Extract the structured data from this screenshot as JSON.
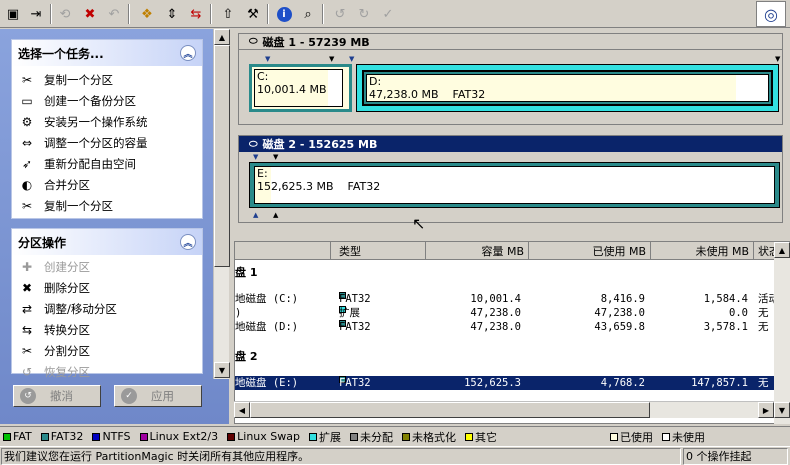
{
  "toolbar": {
    "icons": [
      "new-icon",
      "export-icon",
      "undo-disabled-icon",
      "delete-icon",
      "redo-disabled-icon",
      "copy-icon",
      "resize-icon",
      "move-icon",
      "up-icon",
      "tools-icon",
      "info-icon",
      "search-icon",
      "undo2-disabled-icon",
      "redo2-disabled-icon",
      "apply-disabled-icon"
    ]
  },
  "tasks": {
    "title": "选择一个任务...",
    "items": [
      {
        "label": "复制一个分区",
        "icon": "copy-partition-icon"
      },
      {
        "label": "创建一个备份分区",
        "icon": "backup-icon"
      },
      {
        "label": "安装另一个操作系统",
        "icon": "install-os-icon"
      },
      {
        "label": "调整一个分区的容量",
        "icon": "resize-icon"
      },
      {
        "label": "重新分配自由空间",
        "icon": "redistribute-icon"
      },
      {
        "label": "合并分区",
        "icon": "merge-icon"
      },
      {
        "label": "复制一个分区",
        "icon": "copy-partition-icon"
      }
    ]
  },
  "partition_ops": {
    "title": "分区操作",
    "items": [
      {
        "label": "创建分区",
        "disabled": true
      },
      {
        "label": "删除分区",
        "disabled": false
      },
      {
        "label": "调整/移动分区",
        "disabled": false
      },
      {
        "label": "转换分区",
        "disabled": false
      },
      {
        "label": "分割分区",
        "disabled": false
      },
      {
        "label": "恢复分区",
        "disabled": true
      }
    ]
  },
  "buttons": {
    "undo": "撤消",
    "apply": "应用"
  },
  "disks": [
    {
      "title": "磁盘 1 - 57239 MB",
      "partitions": [
        {
          "letter": "C:",
          "size": "10,001.4 MB",
          "fs": "",
          "used_fraction": 0.84
        },
        {
          "letter": "D:",
          "size": "47,238.0 MB",
          "fs": "FAT32",
          "used_fraction": 0.92
        }
      ]
    },
    {
      "title": "磁盘 2 - 152625 MB",
      "partitions": [
        {
          "letter": "E:",
          "size": "152,625.3 MB",
          "fs": "FAT32",
          "used_fraction": 0.03
        }
      ]
    }
  ],
  "table": {
    "columns": [
      "类型",
      "容量 MB",
      "已使用 MB",
      "未使用 MB",
      "状态"
    ],
    "groups": [
      {
        "name": "盘 1",
        "rows": [
          {
            "name": "地磁盘 (C:)",
            "type": "FAT32",
            "type_color": "#2a8a8a",
            "capacity": "10,001.4",
            "used": "8,416.9",
            "unused": "1,584.4",
            "status": "活动"
          },
          {
            "name": ")",
            "type": "扩展",
            "type_color": "#33e0e0",
            "capacity": "47,238.0",
            "used": "47,238.0",
            "unused": "0.0",
            "status": "无"
          },
          {
            "name": "地磁盘 (D:)",
            "type": "FAT32",
            "type_color": "#2a8a8a",
            "capacity": "47,238.0",
            "used": "43,659.8",
            "unused": "3,578.1",
            "status": "无"
          }
        ]
      },
      {
        "name": "盘 2",
        "rows": [
          {
            "name": "地磁盘 (E:)",
            "type": "FAT32",
            "type_color": "#2a8a8a",
            "capacity": "152,625.3",
            "used": "4,768.2",
            "unused": "147,857.1",
            "status": "无"
          }
        ]
      }
    ]
  },
  "legend": [
    {
      "label": "FAT",
      "color": "#00c000"
    },
    {
      "label": "FAT32",
      "color": "#2a8a8a"
    },
    {
      "label": "NTFS",
      "color": "#0000c0"
    },
    {
      "label": "Linux Ext2/3",
      "color": "#a000a0"
    },
    {
      "label": "Linux Swap",
      "color": "#600000"
    },
    {
      "label": "扩展",
      "color": "#33e0e0"
    },
    {
      "label": "未分配",
      "color": "#808080"
    },
    {
      "label": "未格式化",
      "color": "#808000"
    },
    {
      "label": "其它",
      "color": "#ffff00"
    },
    {
      "label": "已使用",
      "color": "#fffde0"
    },
    {
      "label": "未使用",
      "color": "#ffffff"
    }
  ],
  "status": {
    "message": "我们建议您在运行 PartitionMagic 时关闭所有其他应用程序。",
    "pending": "0 个操作挂起"
  },
  "colors": {
    "selection": "#0a246a",
    "panel": "#7a93d3",
    "fat32": "#2a8a8a",
    "extended": "#33e0e0"
  }
}
